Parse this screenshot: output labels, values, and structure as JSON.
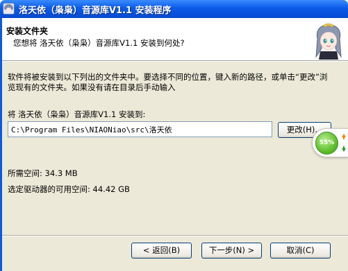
{
  "window": {
    "title": "洛天依（枭枭）音源库V1.1 安装程序"
  },
  "header": {
    "title": "安装文件夹",
    "subtitle": "您想将 洛天依（枭枭）音源库V1.1 安装到何处?"
  },
  "main": {
    "description": "软件将被安装到以下列出的文件夹中。要选择不同的位置，键入新的路径，或单击“更改”浏览现有的文件夹。如果没有请在目录后手动输入",
    "destination_label": "将 洛天依（枭枭）音源库V1.1 安装到:",
    "destination_path": "C:\\Program Files\\NIAONiao\\src\\洛天依",
    "browse_button": "更改(H)...",
    "space_required": "所需空间: 34.3 MB",
    "space_available": "选定驱动器的可用空间: 44.42 GB"
  },
  "footer": {
    "back_button": "< 返回(B)",
    "next_button": "下一步(N) >",
    "cancel_button": "取消(C)"
  },
  "monitor_gadget": {
    "percent": "55%"
  },
  "colors": {
    "titlebar": "#0a5ce8",
    "body": "#ece9d8",
    "accent_green": "#5fbf2e"
  }
}
